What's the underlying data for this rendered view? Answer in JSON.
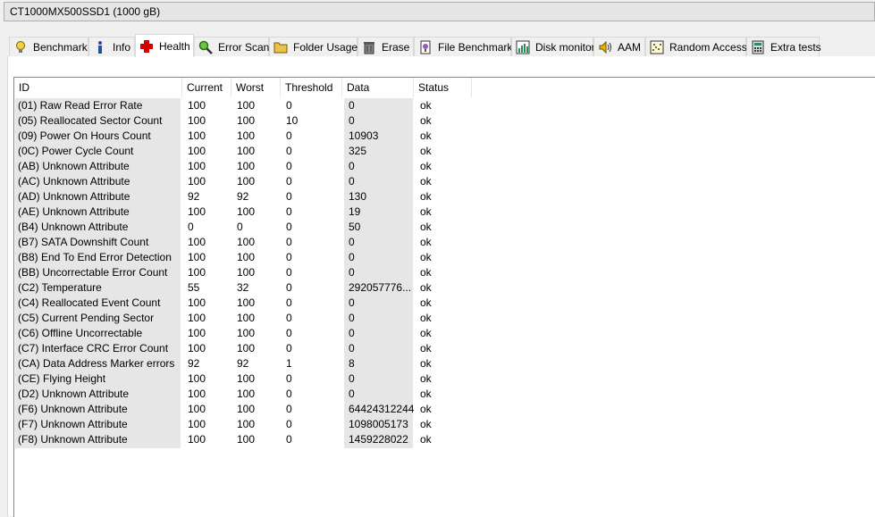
{
  "drive": {
    "selected": "CT1000MX500SSD1 (1000 gB)"
  },
  "tabs": [
    {
      "label": "Benchmark",
      "icon": "lightbulb-icon"
    },
    {
      "label": "Info",
      "icon": "info-icon"
    },
    {
      "label": "Health",
      "icon": "red-cross-icon"
    },
    {
      "label": "Error Scan",
      "icon": "magnifier-icon"
    },
    {
      "label": "Folder Usage",
      "icon": "folder-icon"
    },
    {
      "label": "Erase",
      "icon": "trash-icon"
    },
    {
      "label": "File Benchmark",
      "icon": "file-benchmark-icon"
    },
    {
      "label": "Disk monitor",
      "icon": "chart-icon"
    },
    {
      "label": "AAM",
      "icon": "speaker-icon"
    },
    {
      "label": "Random Access",
      "icon": "scatter-icon"
    },
    {
      "label": "Extra tests",
      "icon": "calculator-icon"
    }
  ],
  "active_tab": "Health",
  "table": {
    "headers": {
      "id": "ID",
      "current": "Current",
      "worst": "Worst",
      "threshold": "Threshold",
      "data": "Data",
      "status": "Status"
    },
    "rows": [
      {
        "id": "(01) Raw Read Error Rate",
        "current": "100",
        "worst": "100",
        "threshold": "0",
        "data": "0",
        "status": "ok"
      },
      {
        "id": "(05) Reallocated Sector Count",
        "current": "100",
        "worst": "100",
        "threshold": "10",
        "data": "0",
        "status": "ok"
      },
      {
        "id": "(09) Power On Hours Count",
        "current": "100",
        "worst": "100",
        "threshold": "0",
        "data": "10903",
        "status": "ok"
      },
      {
        "id": "(0C) Power Cycle Count",
        "current": "100",
        "worst": "100",
        "threshold": "0",
        "data": "325",
        "status": "ok"
      },
      {
        "id": "(AB) Unknown Attribute",
        "current": "100",
        "worst": "100",
        "threshold": "0",
        "data": "0",
        "status": "ok"
      },
      {
        "id": "(AC) Unknown Attribute",
        "current": "100",
        "worst": "100",
        "threshold": "0",
        "data": "0",
        "status": "ok"
      },
      {
        "id": "(AD) Unknown Attribute",
        "current": "92",
        "worst": "92",
        "threshold": "0",
        "data": "130",
        "status": "ok"
      },
      {
        "id": "(AE) Unknown Attribute",
        "current": "100",
        "worst": "100",
        "threshold": "0",
        "data": "19",
        "status": "ok"
      },
      {
        "id": "(B4) Unknown Attribute",
        "current": "0",
        "worst": "0",
        "threshold": "0",
        "data": "50",
        "status": "ok"
      },
      {
        "id": "(B7) SATA Downshift Count",
        "current": "100",
        "worst": "100",
        "threshold": "0",
        "data": "0",
        "status": "ok"
      },
      {
        "id": "(B8) End To End Error Detection",
        "current": "100",
        "worst": "100",
        "threshold": "0",
        "data": "0",
        "status": "ok"
      },
      {
        "id": "(BB) Uncorrectable Error Count",
        "current": "100",
        "worst": "100",
        "threshold": "0",
        "data": "0",
        "status": "ok"
      },
      {
        "id": "(C2) Temperature",
        "current": "55",
        "worst": "32",
        "threshold": "0",
        "data": "292057776...",
        "status": "ok"
      },
      {
        "id": "(C4) Reallocated Event Count",
        "current": "100",
        "worst": "100",
        "threshold": "0",
        "data": "0",
        "status": "ok"
      },
      {
        "id": "(C5) Current Pending Sector",
        "current": "100",
        "worst": "100",
        "threshold": "0",
        "data": "0",
        "status": "ok"
      },
      {
        "id": "(C6) Offline Uncorrectable",
        "current": "100",
        "worst": "100",
        "threshold": "0",
        "data": "0",
        "status": "ok"
      },
      {
        "id": "(C7) Interface CRC Error Count",
        "current": "100",
        "worst": "100",
        "threshold": "0",
        "data": "0",
        "status": "ok"
      },
      {
        "id": "(CA) Data Address Marker errors",
        "current": "92",
        "worst": "92",
        "threshold": "1",
        "data": "8",
        "status": "ok"
      },
      {
        "id": "(CE) Flying Height",
        "current": "100",
        "worst": "100",
        "threshold": "0",
        "data": "0",
        "status": "ok"
      },
      {
        "id": "(D2) Unknown Attribute",
        "current": "100",
        "worst": "100",
        "threshold": "0",
        "data": "0",
        "status": "ok"
      },
      {
        "id": "(F6) Unknown Attribute",
        "current": "100",
        "worst": "100",
        "threshold": "0",
        "data": "64424312244",
        "status": "ok"
      },
      {
        "id": "(F7) Unknown Attribute",
        "current": "100",
        "worst": "100",
        "threshold": "0",
        "data": "1098005173",
        "status": "ok"
      },
      {
        "id": "(F8) Unknown Attribute",
        "current": "100",
        "worst": "100",
        "threshold": "0",
        "data": "1459228022",
        "status": "ok"
      }
    ]
  }
}
